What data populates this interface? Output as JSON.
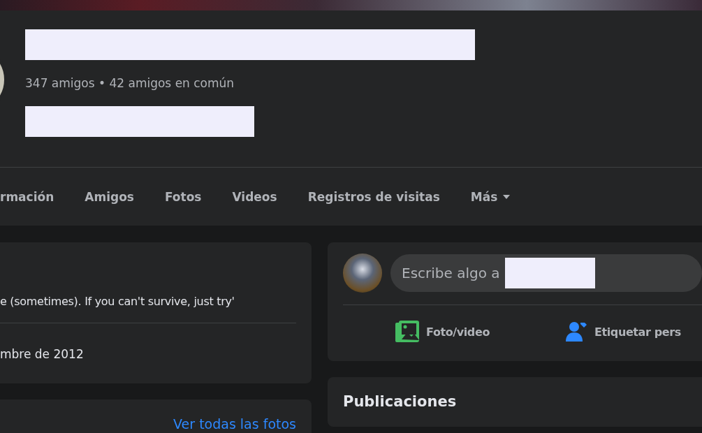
{
  "profile": {
    "friends_summary": "347 amigos • 42 amigos en común"
  },
  "tabs": [
    {
      "label": "rmación",
      "selected": false
    },
    {
      "label": "Amigos",
      "selected": false
    },
    {
      "label": "Fotos",
      "selected": false
    },
    {
      "label": "Videos",
      "selected": false
    },
    {
      "label": "Registros de visitas",
      "selected": false
    },
    {
      "label": "Más",
      "selected": false,
      "kind": "dropdown"
    }
  ],
  "intro": {
    "bio": "e (sometimes). If you can't survive, just try'",
    "joined": "mbre de 2012"
  },
  "photos": {
    "link": "Ver todas las fotos"
  },
  "composer": {
    "placeholder": "Escribe algo a",
    "actions": [
      {
        "kind": "photo",
        "label": "Foto/video"
      },
      {
        "kind": "tag",
        "label": "Etiquetar pers"
      }
    ]
  },
  "posts": {
    "title": "Publicaciones"
  }
}
